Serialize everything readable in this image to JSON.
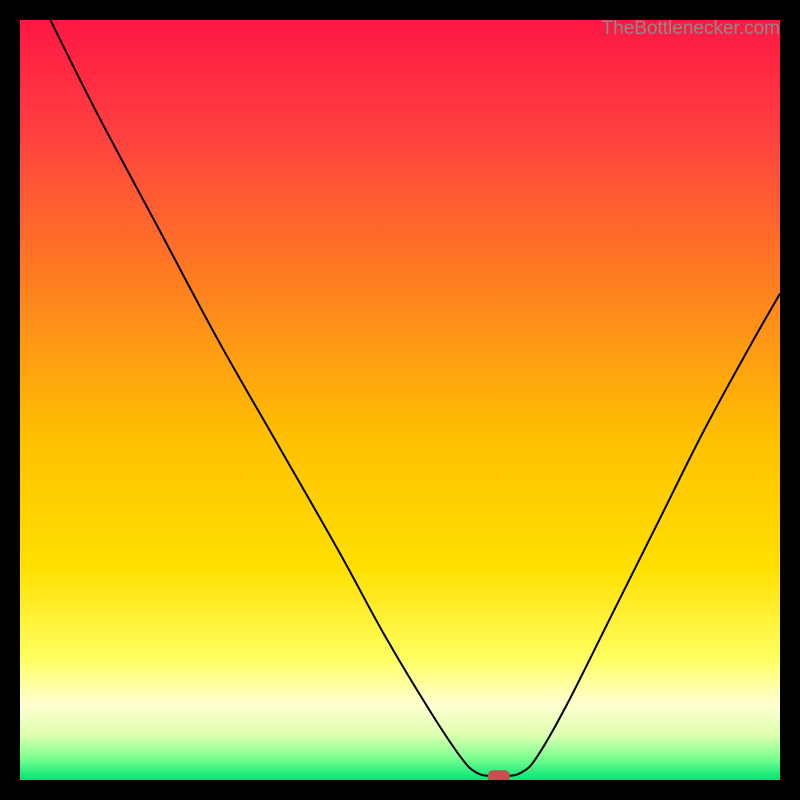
{
  "watermark": "TheBottlenecker.com",
  "chart_data": {
    "type": "line",
    "title": "",
    "xlabel": "",
    "ylabel": "",
    "xlim": [
      0,
      100
    ],
    "ylim": [
      0,
      100
    ],
    "background_gradient": {
      "type": "vertical",
      "stops": [
        {
          "offset": 0,
          "color": "#ff1744"
        },
        {
          "offset": 0.15,
          "color": "#ff4040"
        },
        {
          "offset": 0.35,
          "color": "#ff8020"
        },
        {
          "offset": 0.55,
          "color": "#ffc000"
        },
        {
          "offset": 0.72,
          "color": "#ffe000"
        },
        {
          "offset": 0.84,
          "color": "#ffff60"
        },
        {
          "offset": 0.9,
          "color": "#ffffd0"
        },
        {
          "offset": 0.94,
          "color": "#e0ffb0"
        },
        {
          "offset": 0.97,
          "color": "#80ff90"
        },
        {
          "offset": 1.0,
          "color": "#00e676"
        }
      ]
    },
    "series": [
      {
        "name": "bottleneck-curve",
        "color": "#000000",
        "stroke_width": 2,
        "points": [
          {
            "x": 4,
            "y": 100
          },
          {
            "x": 10,
            "y": 88
          },
          {
            "x": 18,
            "y": 73
          },
          {
            "x": 26,
            "y": 58
          },
          {
            "x": 34,
            "y": 44
          },
          {
            "x": 42,
            "y": 30
          },
          {
            "x": 48,
            "y": 19
          },
          {
            "x": 54,
            "y": 9
          },
          {
            "x": 58,
            "y": 3
          },
          {
            "x": 60,
            "y": 1
          },
          {
            "x": 62,
            "y": 0.5
          },
          {
            "x": 64,
            "y": 0.5
          },
          {
            "x": 66,
            "y": 1
          },
          {
            "x": 68,
            "y": 3
          },
          {
            "x": 72,
            "y": 10
          },
          {
            "x": 78,
            "y": 22
          },
          {
            "x": 84,
            "y": 34
          },
          {
            "x": 90,
            "y": 46
          },
          {
            "x": 96,
            "y": 57
          },
          {
            "x": 100,
            "y": 64
          }
        ]
      }
    ],
    "marker": {
      "x": 63,
      "y": 0.5,
      "color": "#c94f4f",
      "shape": "rounded-rect"
    }
  }
}
